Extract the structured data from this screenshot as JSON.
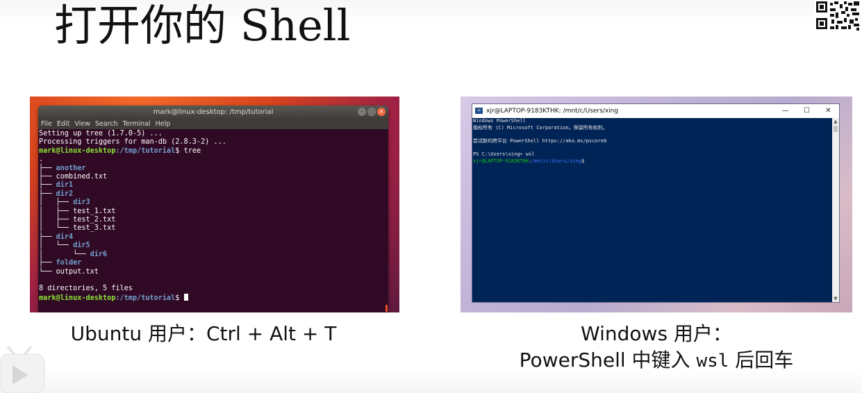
{
  "slide": {
    "title": "打开你的 Shell"
  },
  "ubuntu": {
    "window_title": "mark@linux-desktop: /tmp/tutorial",
    "menu": [
      "File",
      "Edit",
      "View",
      "Search",
      "Terminal",
      "Help"
    ],
    "output_lines": [
      "Setting up tree (1.7.0-5) ...",
      "Processing triggers for man-db (2.8.3-2) ..."
    ],
    "prompt_user": "mark@linux-desktop",
    "prompt_path": ":/tmp/tutorial",
    "prompt_symbol": "$ ",
    "command": "tree",
    "tree_root": ".",
    "tree": [
      {
        "prefix": "├── ",
        "name": "another",
        "dir": true
      },
      {
        "prefix": "├── ",
        "name": "combined.txt",
        "dir": false
      },
      {
        "prefix": "├── ",
        "name": "dir1",
        "dir": true
      },
      {
        "prefix": "├── ",
        "name": "dir2",
        "dir": true
      },
      {
        "prefix": "│   ├── ",
        "name": "dir3",
        "dir": true
      },
      {
        "prefix": "│   ├── ",
        "name": "test_1.txt",
        "dir": false
      },
      {
        "prefix": "│   ├── ",
        "name": "test_2.txt",
        "dir": false
      },
      {
        "prefix": "│   └── ",
        "name": "test_3.txt",
        "dir": false
      },
      {
        "prefix": "├── ",
        "name": "dir4",
        "dir": true
      },
      {
        "prefix": "│   └── ",
        "name": "dir5",
        "dir": true
      },
      {
        "prefix": "│       └── ",
        "name": "dir6",
        "dir": true
      },
      {
        "prefix": "├── ",
        "name": "folder",
        "dir": true
      },
      {
        "prefix": "└── ",
        "name": "output.txt",
        "dir": false
      }
    ],
    "summary": "8 directories, 5 files",
    "caption": "Ubuntu 用户：Ctrl + Alt + T"
  },
  "windows": {
    "window_title": "xjr@LAPTOP-9183KTHK: /mnt/c/Users/xing",
    "lines": [
      "Windows PowerShell",
      "版权所有 (C) Microsoft Corporation。保留所有权利。",
      "",
      "尝试新的跨平台 PowerShell https://aka.ms/pscore6",
      "",
      "PS C:\\Users\\xing> wsl"
    ],
    "prompt_user": "xjr@LAPTOP-9183KTHK",
    "prompt_sep": ":",
    "prompt_path": "/mnt/c/Users/xing",
    "prompt_symbol": "$",
    "caption_line1": "Windows 用户：",
    "caption_line2_a": "PowerShell 中键入 ",
    "caption_line2_code": "wsl",
    "caption_line2_b": " 后回车"
  },
  "icons": {
    "qr": "qr-code-icon",
    "bilibili": "bilibili-tv-icon"
  }
}
